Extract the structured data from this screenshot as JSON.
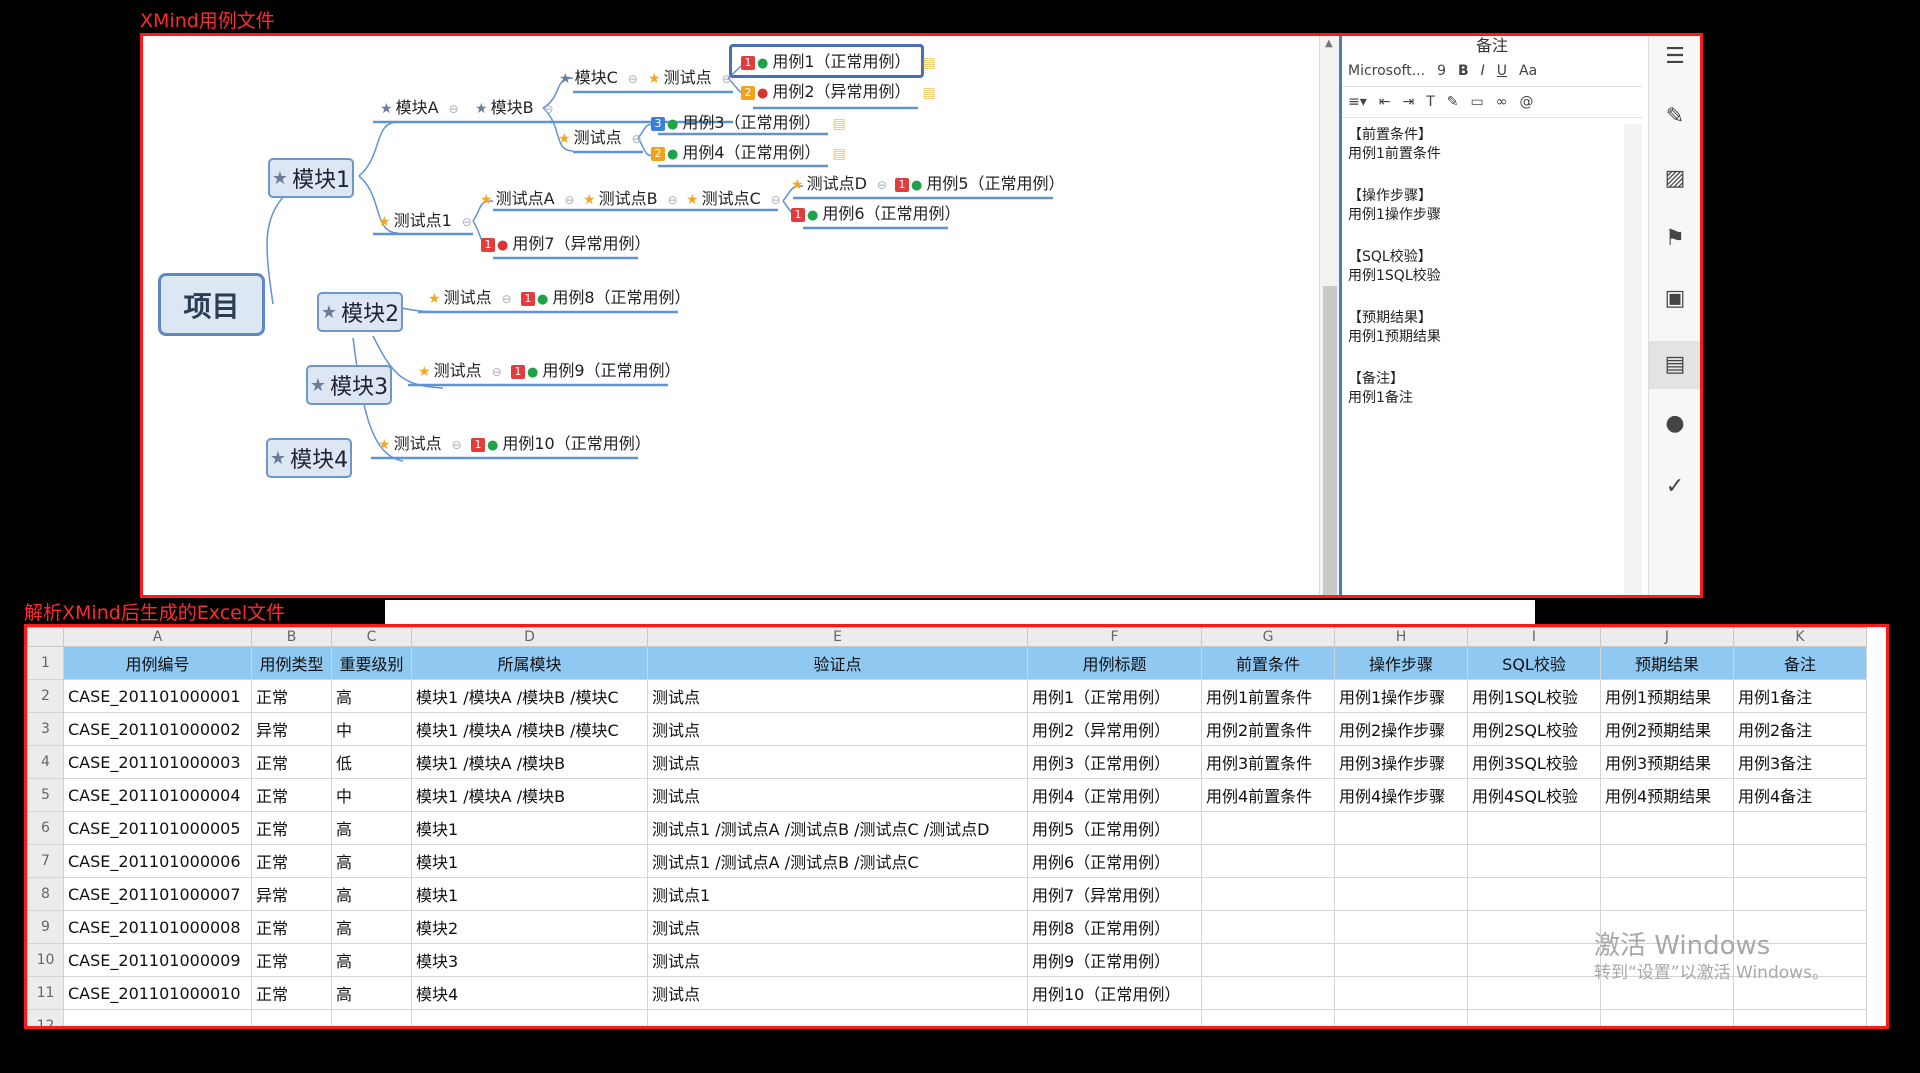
{
  "captions": {
    "xmind": "XMind用例文件",
    "excel": "解析XMind后生成的Excel文件"
  },
  "mindmap": {
    "root": "项目",
    "modules": [
      "模块1",
      "模块2",
      "模块3",
      "模块4"
    ],
    "modA": "模块A",
    "modB": "模块B",
    "modC": "模块C",
    "tp": "测试点",
    "tp1": "测试点1",
    "tpA": "测试点A",
    "tpB": "测试点B",
    "tpC": "测试点C",
    "tpD": "测试点D",
    "cases": [
      {
        "label": "用例1（正常用例）",
        "priority": "1"
      },
      {
        "label": "用例2（异常用例）",
        "priority": "2"
      },
      {
        "label": "用例3（正常用例）",
        "priority": "3"
      },
      {
        "label": "用例4（正常用例）",
        "priority": "2"
      },
      {
        "label": "用例5（正常用例）",
        "priority": "1"
      },
      {
        "label": "用例6（正常用例）",
        "priority": "1"
      },
      {
        "label": "用例7（异常用例）",
        "priority": "1"
      },
      {
        "label": "用例8（正常用例）",
        "priority": "1"
      },
      {
        "label": "用例9（正常用例）",
        "priority": "1"
      },
      {
        "label": "用例10（正常用例）",
        "priority": "1"
      }
    ]
  },
  "notes_panel": {
    "title": "备注",
    "font_name": "Microsoft...",
    "font_size": "9",
    "sections": [
      {
        "head": "【前置条件】",
        "body": "用例1前置条件"
      },
      {
        "head": "【操作步骤】",
        "body": "用例1操作步骤"
      },
      {
        "head": "【SQL校验】",
        "body": "用例1SQL校验"
      },
      {
        "head": "【预期结果】",
        "body": "用例1预期结果"
      },
      {
        "head": "【备注】",
        "body": "用例1备注"
      }
    ]
  },
  "excel": {
    "col_letters": [
      "A",
      "B",
      "C",
      "D",
      "E",
      "F",
      "G",
      "H",
      "I",
      "J",
      "K"
    ],
    "headers": [
      "用例编号",
      "用例类型",
      "重要级别",
      "所属模块",
      "验证点",
      "用例标题",
      "前置条件",
      "操作步骤",
      "SQL校验",
      "预期结果",
      "备注"
    ],
    "rows": [
      [
        "CASE_201101000001",
        "正常",
        "高",
        "模块1 /模块A /模块B /模块C",
        "测试点",
        "用例1（正常用例）",
        "用例1前置条件",
        "用例1操作步骤",
        "用例1SQL校验",
        "用例1预期结果",
        "用例1备注"
      ],
      [
        "CASE_201101000002",
        "异常",
        "中",
        "模块1 /模块A /模块B /模块C",
        "测试点",
        "用例2（异常用例）",
        "用例2前置条件",
        "用例2操作步骤",
        "用例2SQL校验",
        "用例2预期结果",
        "用例2备注"
      ],
      [
        "CASE_201101000003",
        "正常",
        "低",
        "模块1 /模块A /模块B",
        "测试点",
        "用例3（正常用例）",
        "用例3前置条件",
        "用例3操作步骤",
        "用例3SQL校验",
        "用例3预期结果",
        "用例3备注"
      ],
      [
        "CASE_201101000004",
        "正常",
        "中",
        "模块1 /模块A /模块B",
        "测试点",
        "用例4（正常用例）",
        "用例4前置条件",
        "用例4操作步骤",
        "用例4SQL校验",
        "用例4预期结果",
        "用例4备注"
      ],
      [
        "CASE_201101000005",
        "正常",
        "高",
        "模块1",
        "测试点1 /测试点A /测试点B /测试点C /测试点D",
        "用例5（正常用例）",
        "",
        "",
        "",
        "",
        ""
      ],
      [
        "CASE_201101000006",
        "正常",
        "高",
        "模块1",
        "测试点1 /测试点A /测试点B /测试点C",
        "用例6（正常用例）",
        "",
        "",
        "",
        "",
        ""
      ],
      [
        "CASE_201101000007",
        "异常",
        "高",
        "模块1",
        "测试点1",
        "用例7（异常用例）",
        "",
        "",
        "",
        "",
        ""
      ],
      [
        "CASE_201101000008",
        "正常",
        "高",
        "模块2",
        "测试点",
        "用例8（正常用例）",
        "",
        "",
        "",
        "",
        ""
      ],
      [
        "CASE_201101000009",
        "正常",
        "高",
        "模块3",
        "测试点",
        "用例9（正常用例）",
        "",
        "",
        "",
        "",
        ""
      ],
      [
        "CASE_201101000010",
        "正常",
        "高",
        "模块4",
        "测试点",
        "用例10（正常用例）",
        "",
        "",
        "",
        "",
        ""
      ]
    ],
    "row_numbers": [
      "1",
      "2",
      "3",
      "4",
      "5",
      "6",
      "7",
      "8",
      "9",
      "10",
      "11",
      "12"
    ]
  },
  "watermark": {
    "line1": "激活 Windows",
    "line2": "转到“设置”以激活 Windows。"
  }
}
